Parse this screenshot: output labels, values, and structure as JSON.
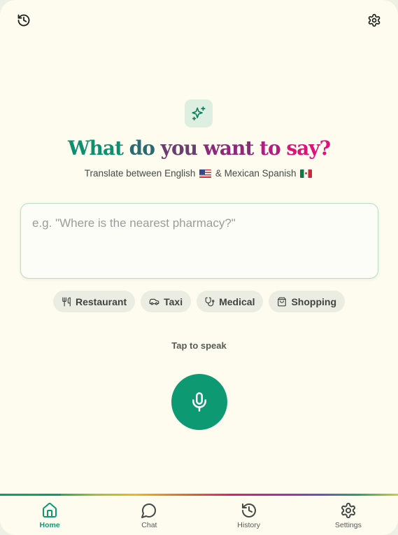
{
  "header": {
    "history_icon": "history-icon",
    "settings_icon": "gear-icon"
  },
  "hero": {
    "icon": "sparkles-icon",
    "headline_words": [
      "What",
      "do",
      "you",
      "want",
      "to",
      "say?"
    ],
    "subtitle_prefix": "Translate between English",
    "subtitle_join": "&",
    "subtitle_suffix": "Mexican Spanish"
  },
  "input": {
    "value": "",
    "placeholder": "e.g. \"Where is the nearest pharmacy?\""
  },
  "quick_phrases": [
    {
      "label": "Restaurant",
      "icon": "utensils-icon"
    },
    {
      "label": "Taxi",
      "icon": "car-icon"
    },
    {
      "label": "Medical",
      "icon": "stethoscope-icon"
    },
    {
      "label": "Shopping",
      "icon": "shopping-bag-icon"
    }
  ],
  "voice": {
    "tap_label": "Tap to speak",
    "icon": "microphone-icon"
  },
  "nav": {
    "active": "Home",
    "items": [
      {
        "label": "Home",
        "icon": "home-icon"
      },
      {
        "label": "Chat",
        "icon": "chat-bubble-icon"
      },
      {
        "label": "History",
        "icon": "history-icon"
      },
      {
        "label": "Settings",
        "icon": "gear-icon"
      }
    ]
  },
  "colors": {
    "accent": "#0d9a72",
    "background": "#fdfcef",
    "headline_start": "#0e8f70",
    "headline_end": "#e0127a"
  }
}
